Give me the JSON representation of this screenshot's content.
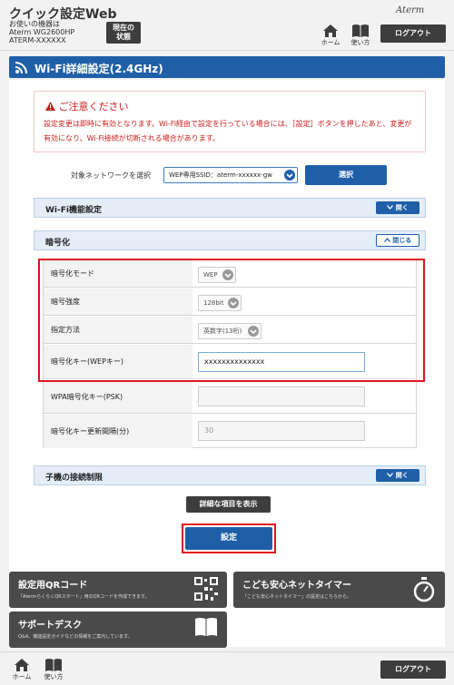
{
  "header": {
    "app_title": "クイック設定Web",
    "device_caption": "お使いの機器は",
    "device_model": "Aterm WG2600HP",
    "device_name": "ATERM-XXXXXX",
    "status_button": [
      "現在の",
      "状態"
    ],
    "brand": "Aterm",
    "home_label": "ホーム",
    "help_label": "使い方",
    "logout_label": "ログアウト"
  },
  "page": {
    "title": "Wi-Fi詳細設定(2.4GHz)"
  },
  "notice": {
    "title": "ご注意ください",
    "body": "設定変更は即時に有効となります。Wi-Fi経由で設定を行っている場合には、［設定］ボタンを押したあと、変更が有効になり、Wi-Fi接続が切断される場合があります。"
  },
  "network": {
    "label": "対象ネットワークを選択",
    "selected": "WEP専用SSID：aterm-xxxxxx-gw",
    "select_button": "選択"
  },
  "sections": {
    "wifi_function": "Wi-Fi機能設定",
    "encryption": "暗号化",
    "child_limit": "子機の接続制限",
    "open_label": "開く",
    "close_label": "閉じる"
  },
  "encryption_rows": [
    {
      "label": "暗号化モード",
      "value": "WEP"
    },
    {
      "label": "暗号強度",
      "value": "128bit"
    },
    {
      "label": "指定方法",
      "value": "英数字(13桁)"
    },
    {
      "label": "暗号化キー(WEPキー)",
      "value": "xxxxxxxxxxxxxx"
    },
    {
      "label": "WPA暗号化キー(PSK)",
      "value": ""
    },
    {
      "label": "暗号化キー更新間隔(分)",
      "value": "30"
    }
  ],
  "actions": {
    "details": "詳細な項目を表示",
    "apply": "設定"
  },
  "tiles": [
    {
      "title": "設定用QRコード",
      "subtitle": "「AtermらくらくQRスタート」用のQRコードを作成できます。"
    },
    {
      "title": "こども安心ネットタイマー",
      "subtitle": "「こども安心ネットタイマー」の設定はこちらから。"
    },
    {
      "title": "サポートデスク",
      "subtitle": "Q&A、機能設定ガイドなどの情報をご案内しています。"
    }
  ],
  "colors": {
    "accent": "#1f5fa8",
    "highlight": "#e0141e",
    "warning_text": "#c81e1e"
  }
}
